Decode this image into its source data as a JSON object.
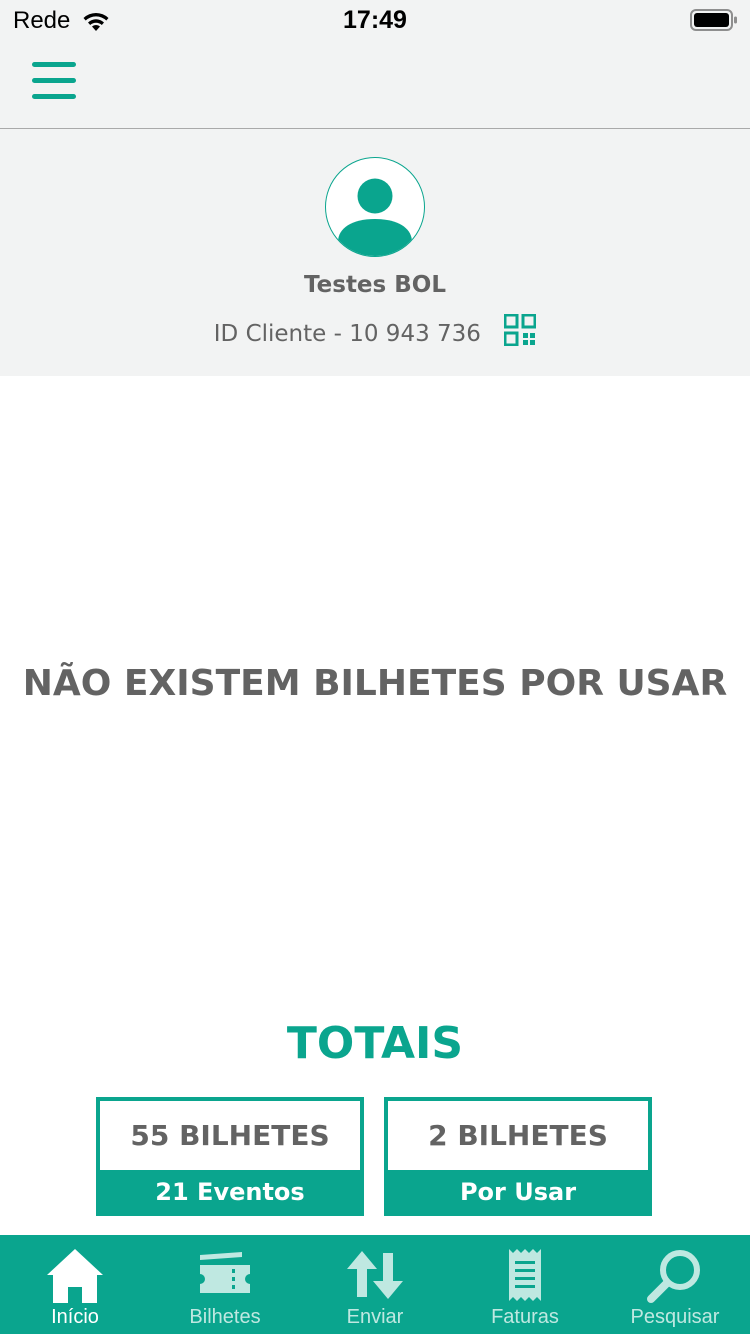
{
  "status_bar": {
    "carrier": "Rede",
    "time": "17:49",
    "icons": [
      "wifi-icon",
      "battery-icon"
    ]
  },
  "nav": {
    "menu_icon": "hamburger-menu-icon"
  },
  "profile": {
    "name": "Testes BOL",
    "client_id": "ID Cliente - 10 943 736",
    "avatar_icon": "user-avatar-icon",
    "qr_icon": "qr-code-icon"
  },
  "main": {
    "empty_message": "NÃO EXISTEM BILHETES POR USAR"
  },
  "totals": {
    "title": "TOTAIS",
    "cards": [
      {
        "top": "55 BILHETES",
        "bottom": "21 Eventos"
      },
      {
        "top": "2 BILHETES",
        "bottom": "Por Usar"
      }
    ]
  },
  "tab_bar": {
    "active": "Início",
    "tabs": [
      {
        "label": "Início",
        "icon": "home-icon"
      },
      {
        "label": "Bilhetes",
        "icon": "ticket-icon"
      },
      {
        "label": "Enviar",
        "icon": "transfer-arrows-icon"
      },
      {
        "label": "Faturas",
        "icon": "receipt-icon"
      },
      {
        "label": "Pesquisar",
        "icon": "search-icon"
      }
    ]
  },
  "colors": {
    "accent": "#0aa58e",
    "text": "#636363",
    "header_bg": "#f2f3f3"
  }
}
